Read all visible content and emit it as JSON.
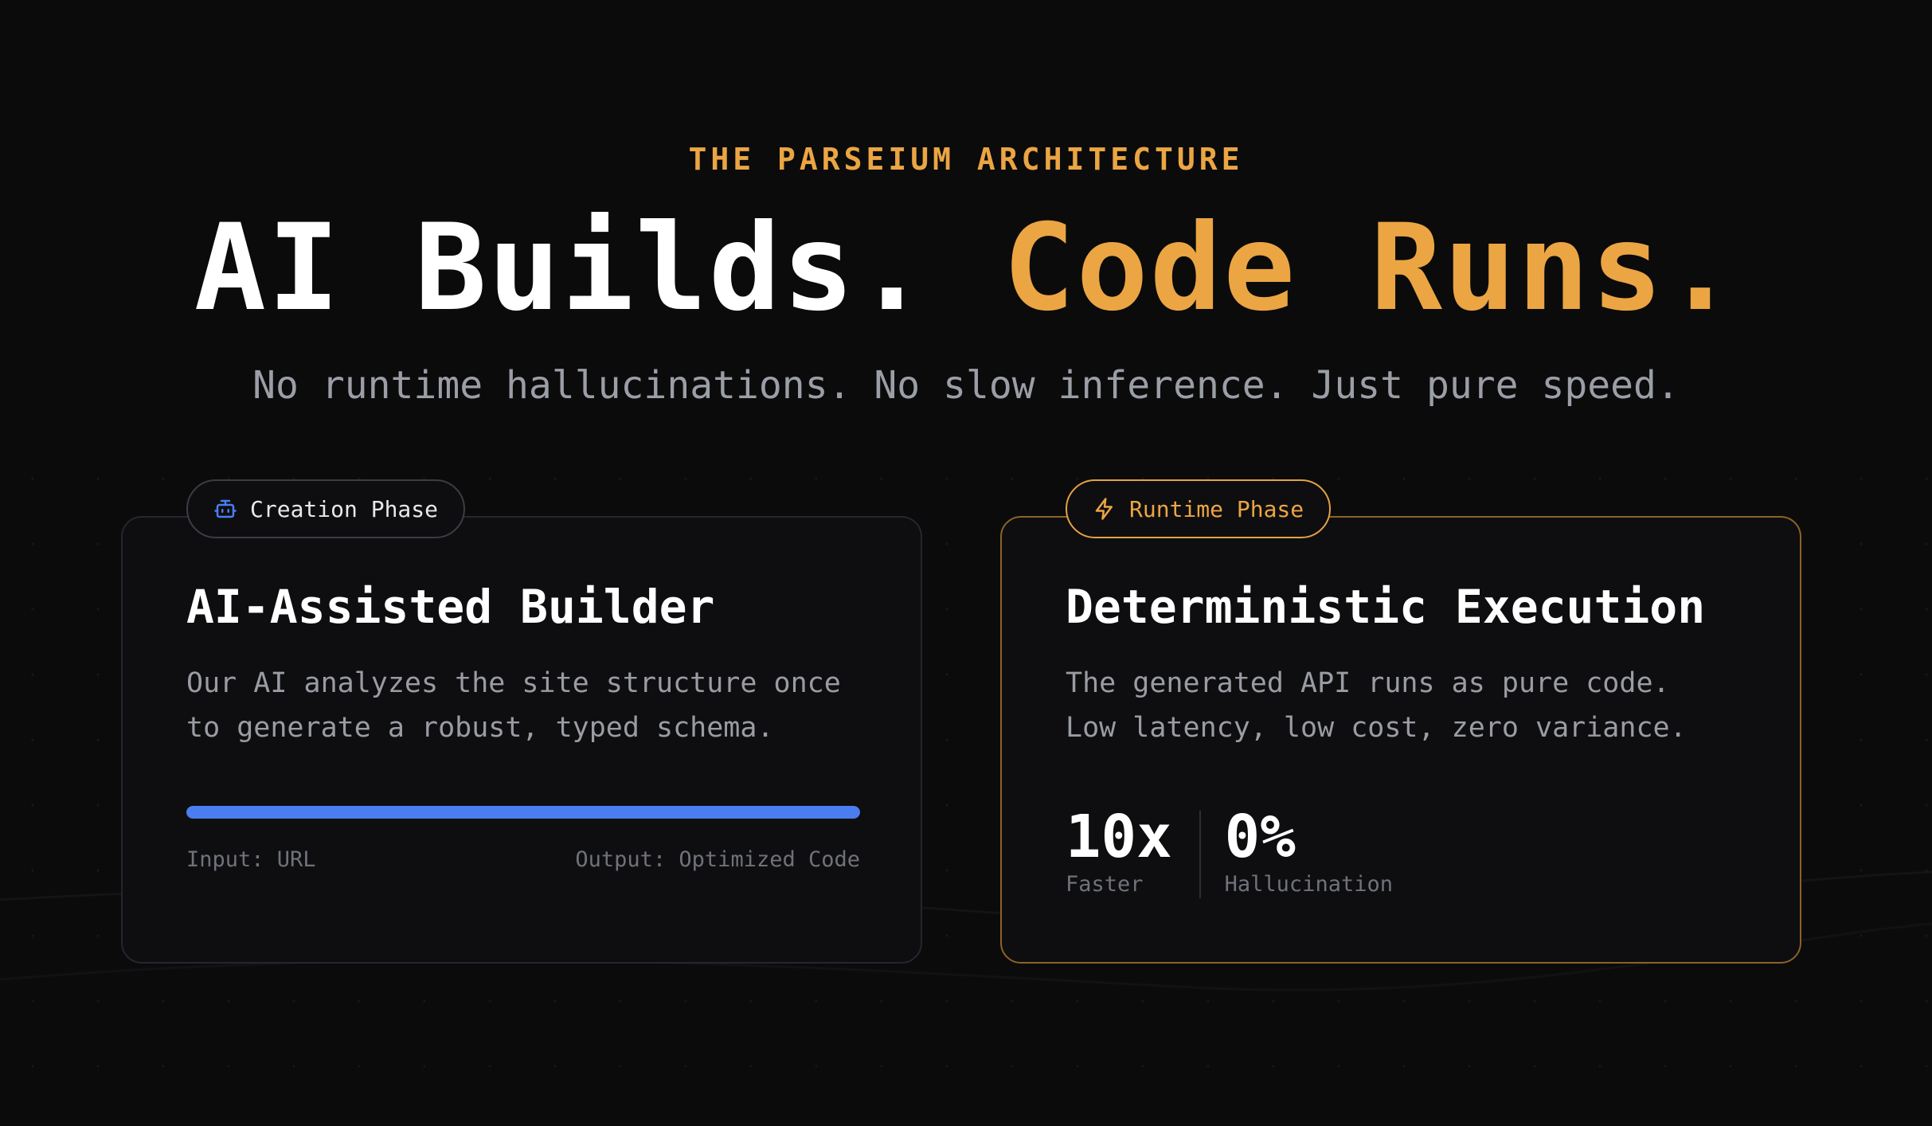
{
  "header": {
    "eyebrow": "THE PARSEIUM ARCHITECTURE",
    "headline_part1": "AI Builds.",
    "headline_part2": "Code Runs.",
    "subheadline": "No runtime hallucinations. No slow inference. Just pure speed."
  },
  "cards": {
    "creation": {
      "badge_icon": "robot-icon",
      "badge_label": "Creation Phase",
      "title": "AI-Assisted Builder",
      "description_lines": [
        "Our AI analyzes the site structure once",
        "to generate a robust, typed schema."
      ],
      "progress_fraction": 1.0,
      "input_label": "Input: URL",
      "output_label": "Output: Optimized Code"
    },
    "runtime": {
      "badge_icon": "lightning-icon",
      "badge_label": "Runtime Phase",
      "title": "Deterministic Execution",
      "description_lines": [
        "The generated API runs as pure code.",
        "Low latency, low cost, zero variance."
      ],
      "stats": [
        {
          "value": "10x",
          "label": "Faster"
        },
        {
          "value": "0%",
          "label": "Hallucination"
        }
      ]
    }
  },
  "colors": {
    "background": "#0b0b0c",
    "accent_orange": "#eba543",
    "accent_blue": "#4a7ef0",
    "muted_text": "#9a9ca3"
  }
}
